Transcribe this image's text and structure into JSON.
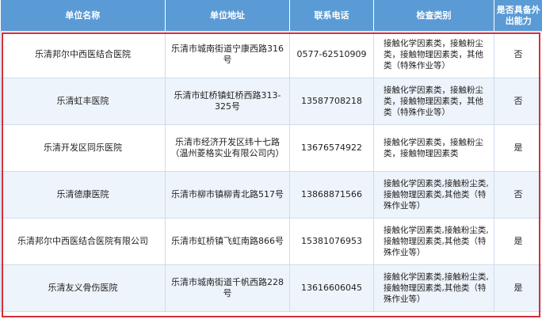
{
  "header": {
    "name": "单位名称",
    "address": "单位地址",
    "phone": "联系电话",
    "category": "检查类别",
    "ability": "是否具备外出能力"
  },
  "rows": [
    {
      "name": "乐清邦尔中西医结合医院",
      "address": "乐清市城南街道宁康西路316号",
      "phone": "0577-62510909",
      "category": "接触化学因素类，接触粉尘类，接触物理因素类，其他类（特殊作业等）",
      "ability": "否"
    },
    {
      "name": "乐清虹丰医院",
      "address": "乐清市虹桥镇虹桥西路313-325号",
      "phone": "13587708218",
      "category": "接触化学因素类，接触粉尘类，接触物理因素类，其他类（特殊作业等）",
      "ability": "否"
    },
    {
      "name": "乐清开发区同乐医院",
      "address": "乐清市经济开发区纬十七路（温州菱格实业有限公司内）",
      "phone": "13676574922",
      "category": "接触化学因素类，接触粉尘类，接触物理因素类",
      "ability": "是"
    },
    {
      "name": "乐清德康医院",
      "address": "乐清市柳市镇柳青北路517号",
      "phone": "13868871566",
      "category": "接触化学因素类,接触粉尘类,接触物理因素类,其他类（特殊作业等）",
      "ability": "否"
    },
    {
      "name": "乐清邦尔中西医结合医院有限公司",
      "address": "乐清市虹桥镇飞虹南路866号",
      "phone": "15381076953",
      "category": "接触化学因素类,接触粉尘类,接触物理因素类,其他类（特殊作业等）",
      "ability": "是"
    },
    {
      "name": "乐清友义骨伤医院",
      "address": "乐清市城南街道千帆西路228号",
      "phone": "13616606045",
      "category": "接触化学因素类,接触粉尘类,接触物理因素类,其他类（特殊作业等）",
      "ability": "是"
    }
  ],
  "colors": {
    "header_bg": "#5b9bd5",
    "highlight_border": "#d62e3a"
  }
}
